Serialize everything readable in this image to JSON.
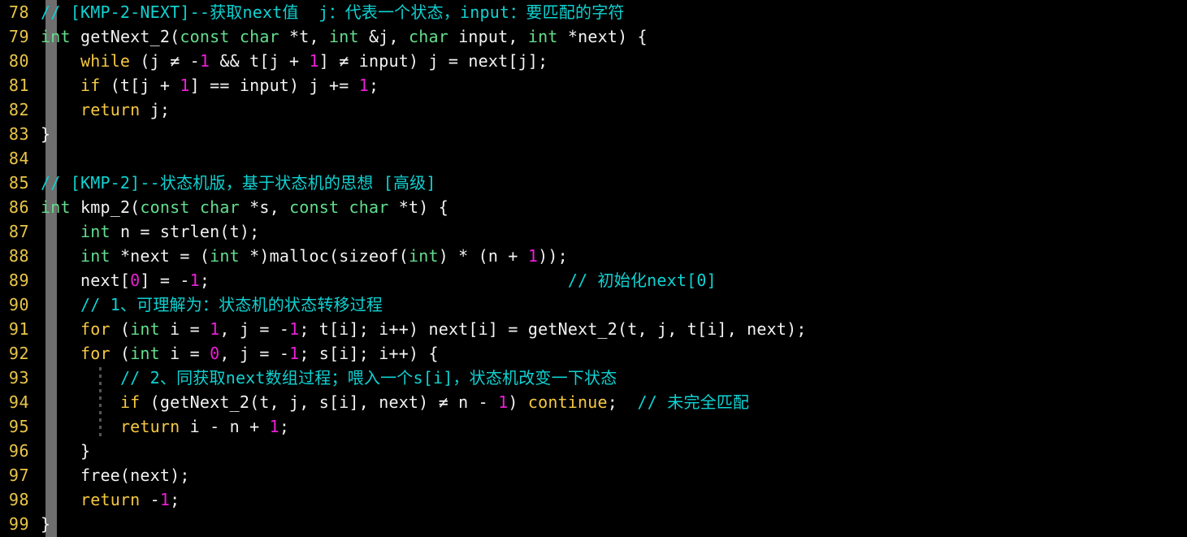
{
  "editor": {
    "background_color": "#000000",
    "scope_bar_color": "#6e6e6e",
    "line_number_color": "#e8c547",
    "colors": {
      "comment": "#0fd2d2",
      "keyword": "#f5c842",
      "type": "#63de8e",
      "number": "#ea1fd5",
      "text": "#f2f2f2"
    },
    "first_line": 78,
    "last_line": 99,
    "language": "C"
  },
  "lines": [
    {
      "number": "78",
      "tokens": [
        {
          "t": "// [KMP-2-NEXT]--获取next值  j：代表一个状态，input：要匹配的字符",
          "c": "cmt"
        }
      ]
    },
    {
      "number": "79",
      "tokens": [
        {
          "t": "int",
          "c": "type"
        },
        {
          "t": " getNext_2(",
          "c": "txt"
        },
        {
          "t": "const char",
          "c": "type"
        },
        {
          "t": " *t, ",
          "c": "txt"
        },
        {
          "t": "int",
          "c": "type"
        },
        {
          "t": " &j, ",
          "c": "txt"
        },
        {
          "t": "char",
          "c": "type"
        },
        {
          "t": " input, ",
          "c": "txt"
        },
        {
          "t": "int",
          "c": "type"
        },
        {
          "t": " *next) {",
          "c": "txt"
        }
      ]
    },
    {
      "number": "80",
      "tokens": [
        {
          "t": "    ",
          "c": "txt"
        },
        {
          "t": "while",
          "c": "kw"
        },
        {
          "t": " (j ≠ -",
          "c": "txt"
        },
        {
          "t": "1",
          "c": "num"
        },
        {
          "t": " && t[j + ",
          "c": "txt"
        },
        {
          "t": "1",
          "c": "num"
        },
        {
          "t": "] ≠ input) j = next[j];",
          "c": "txt"
        }
      ]
    },
    {
      "number": "81",
      "tokens": [
        {
          "t": "    ",
          "c": "txt"
        },
        {
          "t": "if",
          "c": "kw"
        },
        {
          "t": " (t[j + ",
          "c": "txt"
        },
        {
          "t": "1",
          "c": "num"
        },
        {
          "t": "] == input) j += ",
          "c": "txt"
        },
        {
          "t": "1",
          "c": "num"
        },
        {
          "t": ";",
          "c": "txt"
        }
      ]
    },
    {
      "number": "82",
      "tokens": [
        {
          "t": "    ",
          "c": "txt"
        },
        {
          "t": "return",
          "c": "kw"
        },
        {
          "t": " j;",
          "c": "txt"
        }
      ]
    },
    {
      "number": "83",
      "tokens": [
        {
          "t": "}",
          "c": "txt"
        }
      ]
    },
    {
      "number": "84",
      "tokens": []
    },
    {
      "number": "85",
      "tokens": [
        {
          "t": "// [KMP-2]--状态机版，基于状态机的思想 [高级]",
          "c": "cmt"
        }
      ]
    },
    {
      "number": "86",
      "tokens": [
        {
          "t": "int",
          "c": "type"
        },
        {
          "t": " kmp_2(",
          "c": "txt"
        },
        {
          "t": "const char",
          "c": "type"
        },
        {
          "t": " *s, ",
          "c": "txt"
        },
        {
          "t": "const char",
          "c": "type"
        },
        {
          "t": " *t) {",
          "c": "txt"
        }
      ]
    },
    {
      "number": "87",
      "tokens": [
        {
          "t": "    ",
          "c": "txt"
        },
        {
          "t": "int",
          "c": "type"
        },
        {
          "t": " n = strlen(t);",
          "c": "txt"
        }
      ]
    },
    {
      "number": "88",
      "tokens": [
        {
          "t": "    ",
          "c": "txt"
        },
        {
          "t": "int",
          "c": "type"
        },
        {
          "t": " *next = (",
          "c": "txt"
        },
        {
          "t": "int",
          "c": "type"
        },
        {
          "t": " *)malloc(sizeof(",
          "c": "txt"
        },
        {
          "t": "int",
          "c": "type"
        },
        {
          "t": ") * (n + ",
          "c": "txt"
        },
        {
          "t": "1",
          "c": "num"
        },
        {
          "t": "));",
          "c": "txt"
        }
      ]
    },
    {
      "number": "89",
      "tokens": [
        {
          "t": "    next[",
          "c": "txt"
        },
        {
          "t": "0",
          "c": "num"
        },
        {
          "t": "] = -",
          "c": "txt"
        },
        {
          "t": "1",
          "c": "num"
        },
        {
          "t": ";",
          "c": "txt"
        },
        {
          "t": "                                    ",
          "c": "txt"
        },
        {
          "t": "// 初始化next[0]",
          "c": "cmt"
        }
      ]
    },
    {
      "number": "90",
      "tokens": [
        {
          "t": "    ",
          "c": "txt"
        },
        {
          "t": "// 1、可理解为：状态机的状态转移过程",
          "c": "cmt"
        }
      ]
    },
    {
      "number": "91",
      "tokens": [
        {
          "t": "    ",
          "c": "txt"
        },
        {
          "t": "for",
          "c": "kw"
        },
        {
          "t": " (",
          "c": "txt"
        },
        {
          "t": "int",
          "c": "type"
        },
        {
          "t": " i = ",
          "c": "txt"
        },
        {
          "t": "1",
          "c": "num"
        },
        {
          "t": ", j = -",
          "c": "txt"
        },
        {
          "t": "1",
          "c": "num"
        },
        {
          "t": "; t[i]; i++) next[i] = getNext_2(t, j, t[i], next);",
          "c": "txt"
        }
      ]
    },
    {
      "number": "92",
      "tokens": [
        {
          "t": "    ",
          "c": "txt"
        },
        {
          "t": "for",
          "c": "kw"
        },
        {
          "t": " (",
          "c": "txt"
        },
        {
          "t": "int",
          "c": "type"
        },
        {
          "t": " i = ",
          "c": "txt"
        },
        {
          "t": "0",
          "c": "num"
        },
        {
          "t": ", j = -",
          "c": "txt"
        },
        {
          "t": "1",
          "c": "num"
        },
        {
          "t": "; s[i]; i++) {",
          "c": "txt"
        }
      ]
    },
    {
      "number": "93",
      "tokens": [
        {
          "t": "        ",
          "c": "txt"
        },
        {
          "t": "// 2、同获取next数组过程；喂入一个s[i]，状态机改变一下状态",
          "c": "cmt"
        }
      ]
    },
    {
      "number": "94",
      "tokens": [
        {
          "t": "        ",
          "c": "txt"
        },
        {
          "t": "if",
          "c": "kw"
        },
        {
          "t": " (getNext_2(t, j, s[i], next) ≠ n - ",
          "c": "txt"
        },
        {
          "t": "1",
          "c": "num"
        },
        {
          "t": ") ",
          "c": "txt"
        },
        {
          "t": "continue",
          "c": "kw"
        },
        {
          "t": ";  ",
          "c": "txt"
        },
        {
          "t": "// 未完全匹配",
          "c": "cmt"
        }
      ]
    },
    {
      "number": "95",
      "tokens": [
        {
          "t": "        ",
          "c": "txt"
        },
        {
          "t": "return",
          "c": "kw"
        },
        {
          "t": " i - n + ",
          "c": "txt"
        },
        {
          "t": "1",
          "c": "num"
        },
        {
          "t": ";",
          "c": "txt"
        }
      ]
    },
    {
      "number": "96",
      "tokens": [
        {
          "t": "    }",
          "c": "txt"
        }
      ]
    },
    {
      "number": "97",
      "tokens": [
        {
          "t": "    free(next);",
          "c": "txt"
        }
      ]
    },
    {
      "number": "98",
      "tokens": [
        {
          "t": "    ",
          "c": "txt"
        },
        {
          "t": "return",
          "c": "kw"
        },
        {
          "t": " -",
          "c": "txt"
        },
        {
          "t": "1",
          "c": "num"
        },
        {
          "t": ";",
          "c": "txt"
        }
      ]
    },
    {
      "number": "99",
      "tokens": [
        {
          "t": "}",
          "c": "txt"
        }
      ]
    }
  ]
}
